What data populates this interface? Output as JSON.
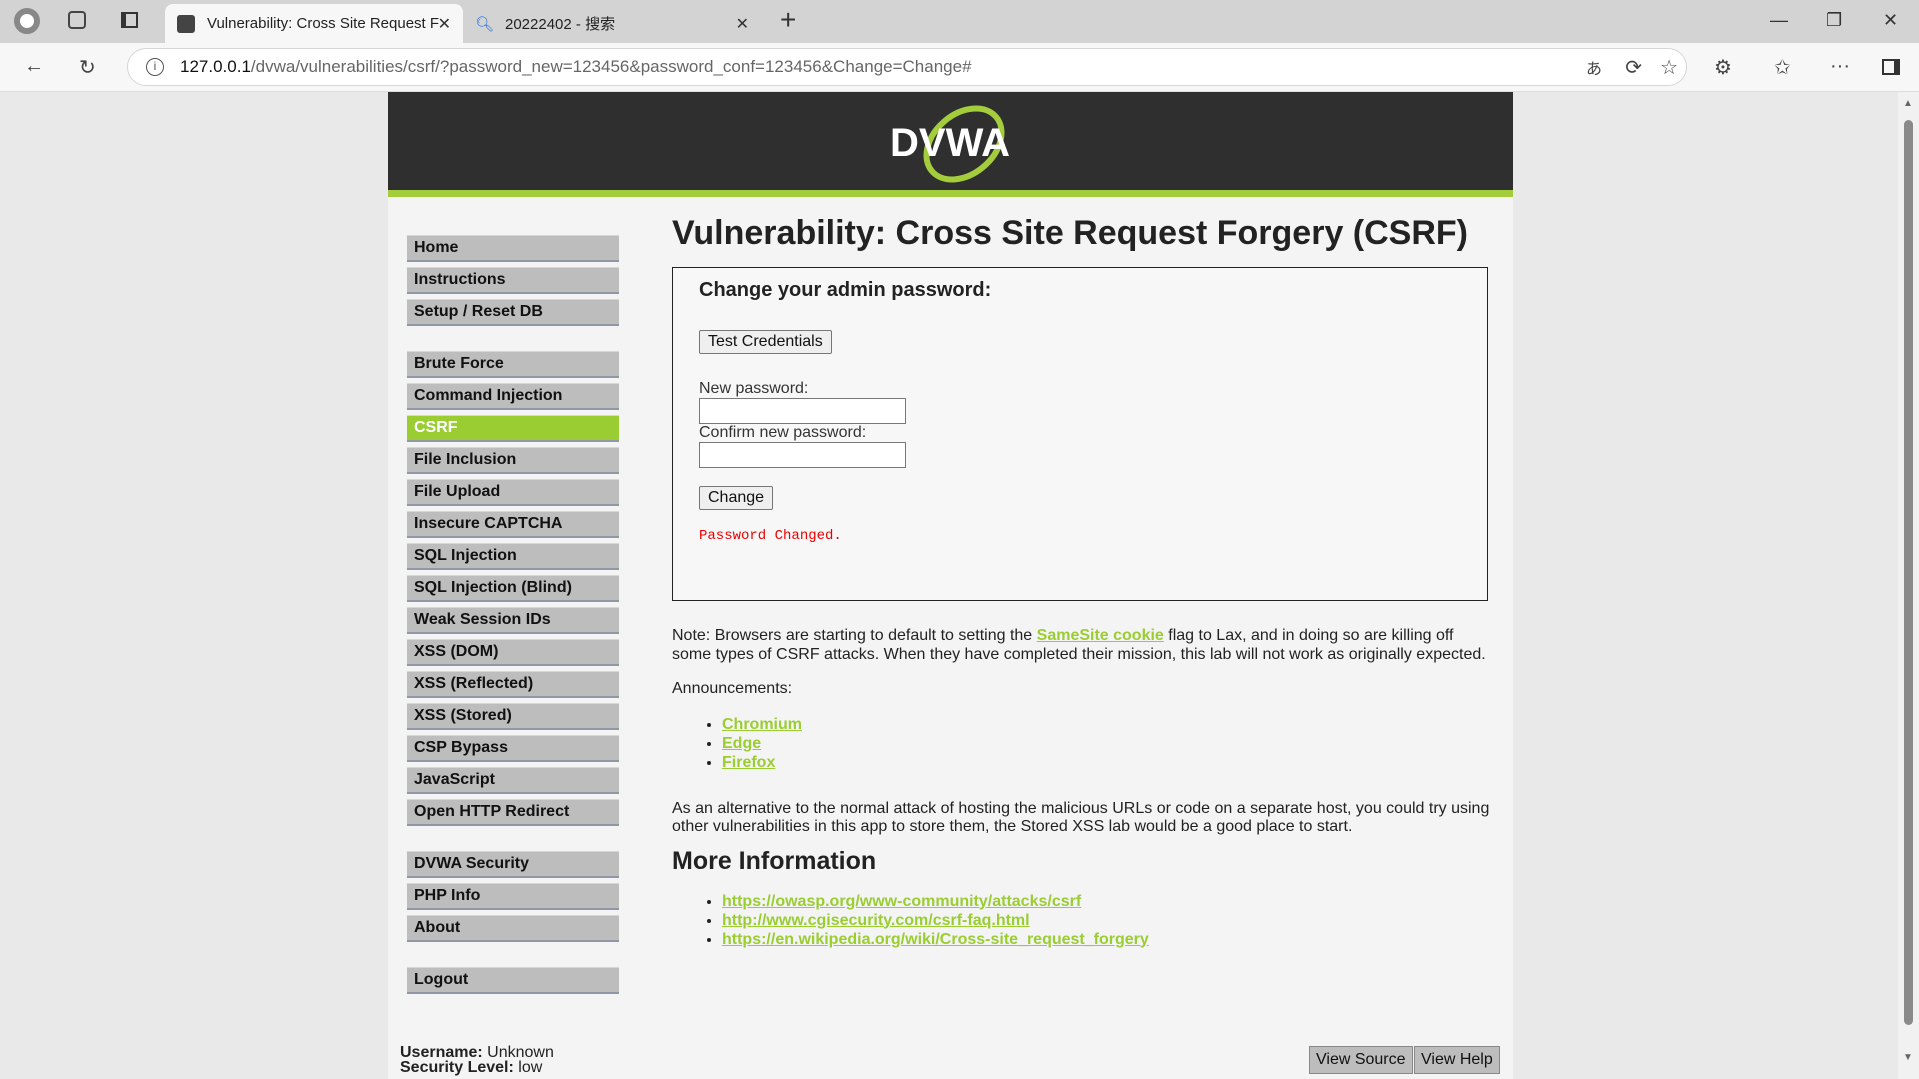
{
  "browser": {
    "tabs": [
      {
        "title": "Vulnerability: Cross Site Request F",
        "active": true
      },
      {
        "title": "20222402 - 搜索",
        "active": false
      }
    ],
    "url_host": "127.0.0.1",
    "url_path": "/dvwa/vulnerabilities/csrf/?password_new=123456&password_conf=123456&Change=Change#",
    "new_tab": "+"
  },
  "logo": "DVWA",
  "menu": {
    "group1": [
      "Home",
      "Instructions",
      "Setup / Reset DB"
    ],
    "group2": [
      "Brute Force",
      "Command Injection",
      "CSRF",
      "File Inclusion",
      "File Upload",
      "Insecure CAPTCHA",
      "SQL Injection",
      "SQL Injection (Blind)",
      "Weak Session IDs",
      "XSS (DOM)",
      "XSS (Reflected)",
      "XSS (Stored)",
      "CSP Bypass",
      "JavaScript",
      "Open HTTP Redirect"
    ],
    "group3": [
      "DVWA Security",
      "PHP Info",
      "About"
    ],
    "group4": [
      "Logout"
    ],
    "selected": "CSRF"
  },
  "main": {
    "title": "Vulnerability: Cross Site Request Forgery (CSRF)",
    "form": {
      "heading": "Change your admin password:",
      "test_button": "Test Credentials",
      "new_label": "New password:",
      "new_value": "",
      "confirm_label": "Confirm new password:",
      "confirm_value": "",
      "change_button": "Change",
      "message": "Password Changed."
    },
    "note_pre": "Note: Browsers are starting to default to setting the ",
    "note_link": "SameSite cookie",
    "note_post": " flag to Lax, and in doing so are killing off some types of CSRF attacks. When they have completed their mission, this lab will not work as originally expected.",
    "announcements_label": "Announcements:",
    "announcements": [
      "Chromium",
      "Edge",
      "Firefox"
    ],
    "alternative": "As an alternative to the normal attack of hosting the malicious URLs or code on a separate host, you could try using other vulnerabilities in this app to store them, the Stored XSS lab would be a good place to start.",
    "more_info_title": "More Information",
    "links": [
      "https://owasp.org/www-community/attacks/csrf",
      "http://www.cgisecurity.com/csrf-faq.html",
      "https://en.wikipedia.org/wiki/Cross-site_request_forgery"
    ]
  },
  "footer": {
    "username_label": "Username:",
    "username": "Unknown",
    "security_label": "Security Level:",
    "security": "low",
    "view_source": "View Source",
    "view_help": "View Help"
  },
  "colors": {
    "accent": "#9acd32",
    "header": "#2f2f2f",
    "message": "#ee0000"
  }
}
